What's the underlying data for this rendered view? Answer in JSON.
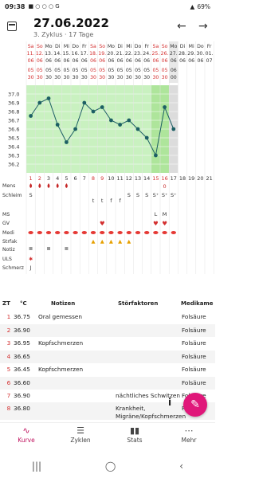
{
  "status_bar": {
    "time": "09:38",
    "battery": "69%"
  },
  "header": {
    "title": "27.06.2022",
    "subtitle": "3. Zyklus · 17 Tage",
    "calendar_icon": "calendar-icon",
    "prev_icon": "arrow-left-icon",
    "next_icon": "arrow-right-icon"
  },
  "day_header": {
    "weekdays": [
      "Sa",
      "So",
      "Mo",
      "Di",
      "Mi",
      "Do",
      "Fr",
      "Sa",
      "So",
      "Mo",
      "Di",
      "Mi",
      "Do",
      "Fr",
      "Sa",
      "So",
      "Mo",
      "Di",
      "Mi",
      "Do",
      "Fr"
    ],
    "dates": [
      "11.",
      "12.",
      "13.",
      "14.",
      "15.",
      "16.",
      "17.",
      "18.",
      "19.",
      "20.",
      "21.",
      "22.",
      "23.",
      "24.",
      "25.",
      "26.",
      "27.",
      "28.",
      "29.",
      "30.",
      "01."
    ],
    "months": [
      "06",
      "06",
      "06",
      "06",
      "06",
      "06",
      "06",
      "06",
      "06",
      "06",
      "06",
      "06",
      "06",
      "06",
      "06",
      "06",
      "06",
      "06",
      "06",
      "06",
      "07"
    ],
    "row4": [
      "05",
      "05",
      "05",
      "05",
      "05",
      "05",
      "05",
      "05",
      "05",
      "05",
      "05",
      "05",
      "05",
      "05",
      "05",
      "05",
      "06",
      "",
      "",
      "",
      ""
    ],
    "row5": [
      "30",
      "30",
      "30",
      "30",
      "30",
      "30",
      "30",
      "30",
      "30",
      "30",
      "30",
      "30",
      "30",
      "30",
      "30",
      "30",
      "00",
      "",
      "",
      "",
      ""
    ]
  },
  "chart_data": {
    "type": "line",
    "x": [
      1,
      2,
      3,
      4,
      5,
      6,
      7,
      8,
      9,
      10,
      11,
      12,
      13,
      14,
      15,
      16,
      17
    ],
    "values": [
      36.75,
      36.9,
      36.95,
      36.65,
      36.45,
      36.6,
      36.9,
      36.8,
      36.85,
      36.7,
      36.65,
      36.7,
      36.6,
      36.5,
      36.3,
      36.85,
      36.6
    ],
    "yticks": [
      "37.0",
      "36.9",
      "36.8",
      "36.7",
      "36.6",
      "36.5",
      "36.4",
      "36.3",
      "36.2"
    ],
    "ylim": [
      36.1,
      37.1
    ],
    "day_numbers": [
      "1",
      "2",
      "3",
      "4",
      "5",
      "6",
      "7",
      "8",
      "9",
      "10",
      "11",
      "12",
      "13",
      "14",
      "15",
      "16",
      "17",
      "18",
      "19",
      "20",
      "21"
    ]
  },
  "symptom_rows": {
    "labels": [
      "Mens",
      "Schleim",
      "MS",
      "GV",
      "Medi",
      "Strfak",
      "Notiz",
      "ULS",
      "Schmerz"
    ],
    "mens_marker": "0",
    "schleim": [
      "S",
      "",
      "",
      "",
      "",
      "",
      "",
      "t",
      "t",
      "f",
      "f",
      "S",
      "S",
      "S",
      "S⁺",
      "S⁺",
      "S⁺"
    ],
    "ms": [
      "",
      "",
      "",
      "",
      "",
      "",
      "",
      "",
      "",
      "",
      "",
      "",
      "",
      "",
      "L",
      "M",
      ""
    ]
  },
  "table": {
    "headers": [
      "ZT",
      "°C",
      "Notizen",
      "Störfaktoren",
      "Medikame"
    ],
    "rows": [
      {
        "zt": "1",
        "temp": "36.75",
        "notes": "Oral gemessen",
        "stor": "",
        "med": "Folsäure"
      },
      {
        "zt": "2",
        "temp": "36.90",
        "notes": "",
        "stor": "",
        "med": "Folsäure"
      },
      {
        "zt": "3",
        "temp": "36.95",
        "notes": "Kopfschmerzen",
        "stor": "",
        "med": "Folsäure"
      },
      {
        "zt": "4",
        "temp": "36.65",
        "notes": "",
        "stor": "",
        "med": "Folsäure"
      },
      {
        "zt": "5",
        "temp": "36.45",
        "notes": "Kopfschmerzen",
        "stor": "",
        "med": "Folsäure"
      },
      {
        "zt": "6",
        "temp": "36.60",
        "notes": "",
        "stor": "",
        "med": "Folsäure"
      },
      {
        "zt": "7",
        "temp": "36.90",
        "notes": "",
        "stor": "nächtliches Schwitzen",
        "med": "Folsäure"
      },
      {
        "zt": "8",
        "temp": "36.80",
        "notes": "",
        "stor": "Krankheit, Migräne/Kopfschmerzen",
        "med": "Folsäure"
      }
    ]
  },
  "fab": {
    "edit_icon": "pencil-icon",
    "info_label": "i"
  },
  "nav": {
    "items": [
      "Kurve",
      "Zyklen",
      "Stats",
      "Mehr"
    ]
  },
  "colors": {
    "accent": "#c0135f",
    "red": "#d32f2f",
    "green_zone": "#c9f1c0",
    "fertile": "#aee59b"
  }
}
